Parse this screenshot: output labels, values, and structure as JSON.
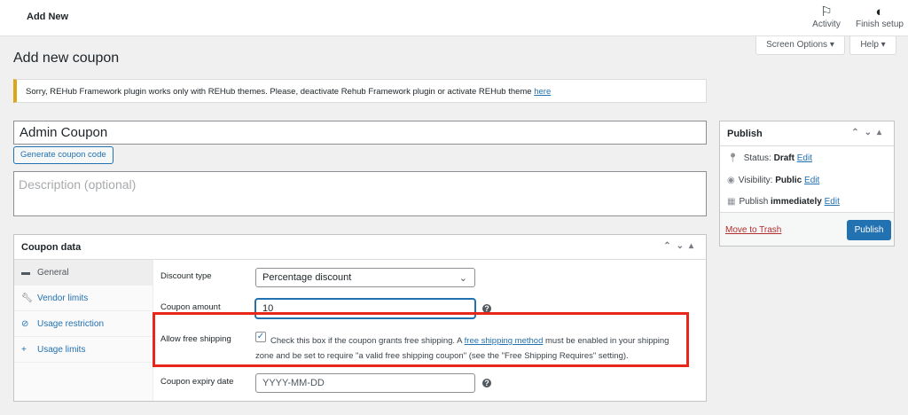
{
  "topbar": {
    "title": "Add New",
    "activity": "Activity",
    "finish_setup": "Finish setup",
    "screen_options": "Screen Options ▾",
    "help": "Help ▾"
  },
  "page_title": "Add new coupon",
  "notice": {
    "text": "Sorry, REHub Framework plugin works only with REHub themes. Please, deactivate Rehub Framework plugin or activate REHub theme ",
    "link": "here",
    "color": "#dba617"
  },
  "coupon_code": "Admin Coupon",
  "generate_button": "Generate coupon code",
  "description_placeholder": "Description (optional)",
  "coupon_data": {
    "title": "Coupon data",
    "tabs": [
      {
        "label": "General",
        "icon": "ticket-icon"
      },
      {
        "label": "Vendor limits",
        "icon": "wrench-icon"
      },
      {
        "label": "Usage restriction",
        "icon": "block-icon"
      },
      {
        "label": "Usage limits",
        "icon": "plus-icon"
      }
    ],
    "discount_type": {
      "label": "Discount type",
      "value": "Percentage discount"
    },
    "coupon_amount": {
      "label": "Coupon amount",
      "value": "10"
    },
    "free_shipping": {
      "label": "Allow free shipping",
      "checked": true,
      "text1": "Check this box if the coupon grants free shipping. A ",
      "link": "free shipping method",
      "text2": " must be enabled in your shipping",
      "text3": "zone and be set to require \"a valid free shipping coupon\" (see the \"Free Shipping Requires\" setting)."
    },
    "expiry": {
      "label": "Coupon expiry date",
      "placeholder": "YYYY-MM-DD"
    }
  },
  "publish": {
    "title": "Publish",
    "status_label": "Status: ",
    "status": "Draft",
    "visibility_label": "Visibility: ",
    "visibility": "Public",
    "publish_label": "Publish ",
    "publish_when": "immediately",
    "edit": "Edit",
    "trash": "Move to Trash",
    "button": "Publish",
    "accent": "#2271b1"
  },
  "highlight_color": "#e8261a"
}
